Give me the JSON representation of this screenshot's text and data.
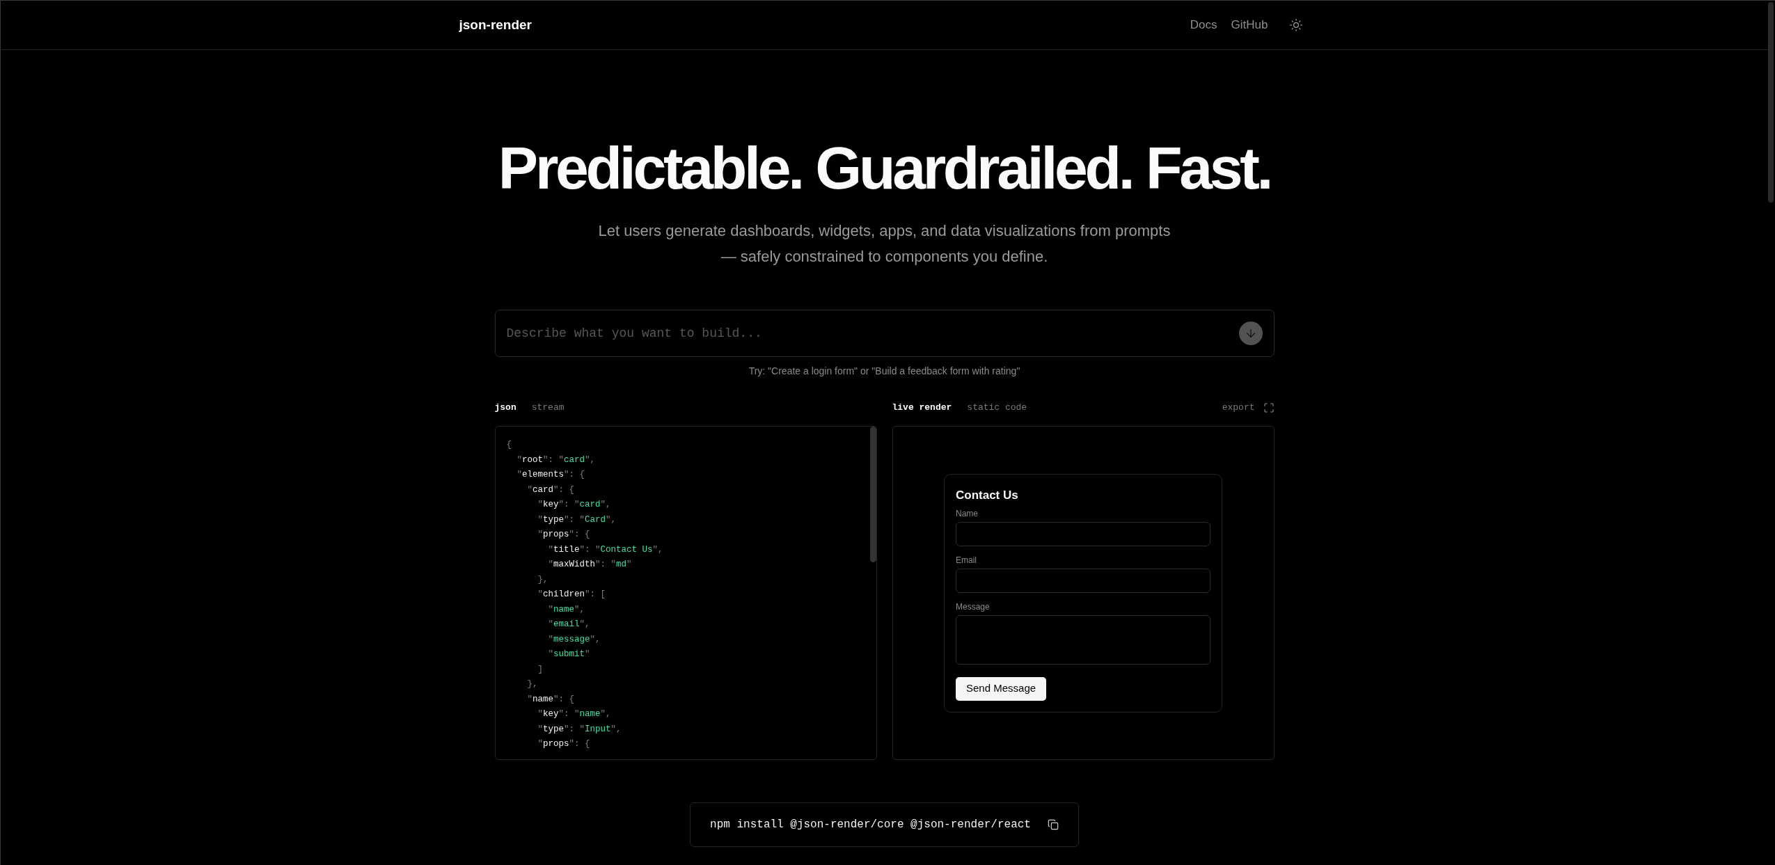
{
  "header": {
    "logo": "json-render",
    "nav_links": [
      "Docs",
      "GitHub"
    ]
  },
  "hero": {
    "title": "Predictable. Guardrailed. Fast.",
    "subtitle": "Let users generate dashboards, widgets, apps, and data visualizations from prompts — safely constrained to components you define."
  },
  "prompt": {
    "placeholder": "Describe what you want to build...",
    "send_button": {
      "disabled": true
    },
    "hint": "Try: \"Create a login form\" or \"Build a feedback form with rating\""
  },
  "code_panel": {
    "tabs": [
      {
        "label": "json",
        "selected": true
      },
      {
        "label": "stream",
        "selected": false
      }
    ],
    "lines": [
      {
        "text": "{",
        "children": [
          {
            "text": "\"root\": \"card\","
          },
          {
            "text": "\"elements\": {",
            "children": [
              {
                "text": "\"card\": {",
                "children": [
                  {
                    "text": "\"key\": \"card\","
                  },
                  {
                    "text": "\"type\": \"Card\","
                  },
                  {
                    "text": "\"props\": {",
                    "children": [
                      {
                        "text": "\"title\": \"Contact Us\","
                      },
                      {
                        "text": "\"maxWidth\": \"md\""
                      }
                    ]
                  },
                  {
                    "text": "},"
                  },
                  {
                    "text": "\"children\": [",
                    "children": [
                      {
                        "text": "\"name\","
                      },
                      {
                        "text": "\"email\","
                      },
                      {
                        "text": "\"message\","
                      },
                      {
                        "text": "\"submit\""
                      }
                    ]
                  },
                  {
                    "text": "]"
                  }
                ]
              },
              {
                "text": "},"
              },
              {
                "text": "\"name\": {",
                "children": [
                  {
                    "text": "\"key\": \"name\","
                  },
                  {
                    "text": "\"type\": \"Input\","
                  },
                  {
                    "text": "\"props\": {"
                  }
                ]
              }
            ]
          }
        ]
      }
    ]
  },
  "preview_panel": {
    "tabs": [
      {
        "label": "live render",
        "selected": true
      },
      {
        "label": "static code",
        "selected": false
      }
    ],
    "export_label": "export",
    "form": {
      "title": "Contact Us",
      "fields": [
        {
          "label": "Name",
          "kind": "input"
        },
        {
          "label": "Email",
          "kind": "input"
        },
        {
          "label": "Message",
          "kind": "textarea"
        }
      ],
      "submit": "Send Message"
    }
  },
  "install": {
    "command": "npm install @json-render/core @json-render/react"
  }
}
